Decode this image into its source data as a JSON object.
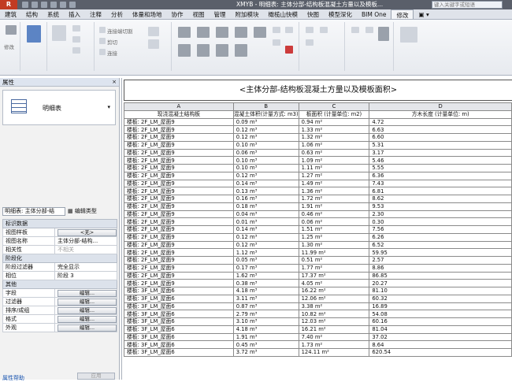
{
  "titlebar": {
    "app_button": "R",
    "title": "XMYB - 明细表: 主体分部-结构板混凝土方量以及模板...",
    "search_placeholder": "键入关键字或短语"
  },
  "ribbon_tabs": [
    {
      "label": "建筑"
    },
    {
      "label": "结构"
    },
    {
      "label": "系统"
    },
    {
      "label": "插入"
    },
    {
      "label": "注释"
    },
    {
      "label": "分析"
    },
    {
      "label": "体量和场地"
    },
    {
      "label": "协作"
    },
    {
      "label": "视图"
    },
    {
      "label": "管理"
    },
    {
      "label": "附加模块"
    },
    {
      "label": "橄榄山快模"
    },
    {
      "label": "快图"
    },
    {
      "label": "模型深化"
    },
    {
      "label": "BIM One"
    },
    {
      "label": "修改",
      "active": true
    },
    {
      "label": "▣ ▾"
    }
  ],
  "ribbon": {
    "modify_label": "修改",
    "cut_label": "剪切",
    "join_label": "连接端切割",
    "connect_label": "连接"
  },
  "properties": {
    "header": "属性",
    "close": "×",
    "type_name": "明细表",
    "type_dropdown": "▾",
    "selector_value": "明细表: 主体分部-结",
    "edit_type": "编辑类型",
    "sections": [
      {
        "name": "标识数据",
        "rows": [
          {
            "label": "视图样板",
            "value": "<无>",
            "button": true
          },
          {
            "label": "视图名称",
            "value": "主体分部-结构..."
          },
          {
            "label": "相关性",
            "value": "不相关",
            "dim": true
          }
        ]
      },
      {
        "name": "阶段化",
        "rows": [
          {
            "label": "阶段过滤器",
            "value": "完全显示"
          },
          {
            "label": "相位",
            "value": "阶段 3"
          }
        ]
      },
      {
        "name": "其他",
        "rows": [
          {
            "label": "字段",
            "value": "编辑...",
            "button": true
          },
          {
            "label": "过滤器",
            "value": "编辑...",
            "button": true
          },
          {
            "label": "排序/成组",
            "value": "编辑...",
            "button": true
          },
          {
            "label": "格式",
            "value": "编辑...",
            "button": true
          },
          {
            "label": "外观",
            "value": "编辑...",
            "button": true
          }
        ]
      }
    ],
    "help_link": "属性帮助",
    "apply_button": "应用"
  },
  "schedule": {
    "title": "<主体分部-结构板混凝土方量以及模板面积>",
    "column_letters": [
      "A",
      "B",
      "C",
      "D"
    ],
    "column_headers": [
      "现浇混凝土结构板",
      "混凝土体积(计量方式: m3)",
      "板面积 (计量单位: m2)",
      "方木长度 (计量单位: m)"
    ],
    "rows": [
      [
        "楼板: 2F_LM_屋面9",
        "0.09 m³",
        "0.94 m²",
        "4.72"
      ],
      [
        "楼板: 2F_LM_屋面9",
        "0.12 m³",
        "1.33 m²",
        "6.63"
      ],
      [
        "楼板: 2F_LM_屋面9",
        "0.12 m³",
        "1.32 m²",
        "6.60"
      ],
      [
        "楼板: 2F_LM_屋面9",
        "0.10 m³",
        "1.06 m²",
        "5.31"
      ],
      [
        "楼板: 2F_LM_屋面9",
        "0.06 m³",
        "0.63 m²",
        "3.17"
      ],
      [
        "楼板: 2F_LM_屋面9",
        "0.10 m³",
        "1.09 m²",
        "5.46"
      ],
      [
        "楼板: 2F_LM_屋面9",
        "0.10 m³",
        "1.11 m²",
        "5.55"
      ],
      [
        "楼板: 2F_LM_屋面9",
        "0.12 m³",
        "1.27 m²",
        "6.36"
      ],
      [
        "楼板: 2F_LM_屋面9",
        "0.14 m³",
        "1.49 m²",
        "7.43"
      ],
      [
        "楼板: 2F_LM_屋面9",
        "0.13 m³",
        "1.36 m²",
        "6.81"
      ],
      [
        "楼板: 2F_LM_屋面9",
        "0.16 m³",
        "1.72 m²",
        "8.62"
      ],
      [
        "楼板: 2F_LM_屋面9",
        "0.18 m³",
        "1.91 m²",
        "9.53"
      ],
      [
        "楼板: 2F_LM_屋面9",
        "0.04 m³",
        "0.46 m²",
        "2.30"
      ],
      [
        "楼板: 2F_LM_屋面9",
        "0.01 m³",
        "0.06 m²",
        "0.30"
      ],
      [
        "楼板: 2F_LM_屋面9",
        "0.14 m³",
        "1.51 m²",
        "7.56"
      ],
      [
        "楼板: 2F_LM_屋面9",
        "0.12 m³",
        "1.25 m²",
        "6.26"
      ],
      [
        "楼板: 2F_LM_屋面9",
        "0.12 m³",
        "1.30 m²",
        "6.52"
      ],
      [
        "楼板: 2F_LM_屋面9",
        "1.12 m³",
        "11.99 m²",
        "59.95"
      ],
      [
        "楼板: 2F_LM_屋面9",
        "0.05 m³",
        "0.51 m²",
        "2.57"
      ],
      [
        "楼板: 2F_LM_屋面9",
        "0.17 m³",
        "1.77 m²",
        "8.86"
      ],
      [
        "楼板: 2F_LM_屋面9",
        "1.62 m³",
        "17.37 m²",
        "86.85"
      ],
      [
        "楼板: 2F_LM_屋面9",
        "0.38 m³",
        "4.05 m²",
        "20.27"
      ],
      [
        "楼板: 3F_LM_屋面6",
        "4.18 m³",
        "16.22 m²",
        "81.10"
      ],
      [
        "楼板: 3F_LM_屋面6",
        "3.11 m³",
        "12.06 m²",
        "60.32"
      ],
      [
        "楼板: 3F_LM_屋面6",
        "0.87 m³",
        "3.38 m²",
        "16.89"
      ],
      [
        "楼板: 3F_LM_屋面6",
        "2.79 m³",
        "10.82 m²",
        "54.08"
      ],
      [
        "楼板: 3F_LM_屋面6",
        "3.10 m³",
        "12.03 m²",
        "60.16"
      ],
      [
        "楼板: 3F_LM_屋面6",
        "4.18 m³",
        "16.21 m²",
        "81.04"
      ],
      [
        "楼板: 3F_LM_屋面6",
        "1.91 m³",
        "7.40 m²",
        "37.02"
      ],
      [
        "楼板: 3F_LM_屋面6",
        "0.45 m³",
        "1.73 m²",
        "8.64"
      ],
      [
        "楼板: 3F_LM_屋面6",
        "3.72 m³",
        "124.11 m²",
        "620.54"
      ]
    ]
  }
}
